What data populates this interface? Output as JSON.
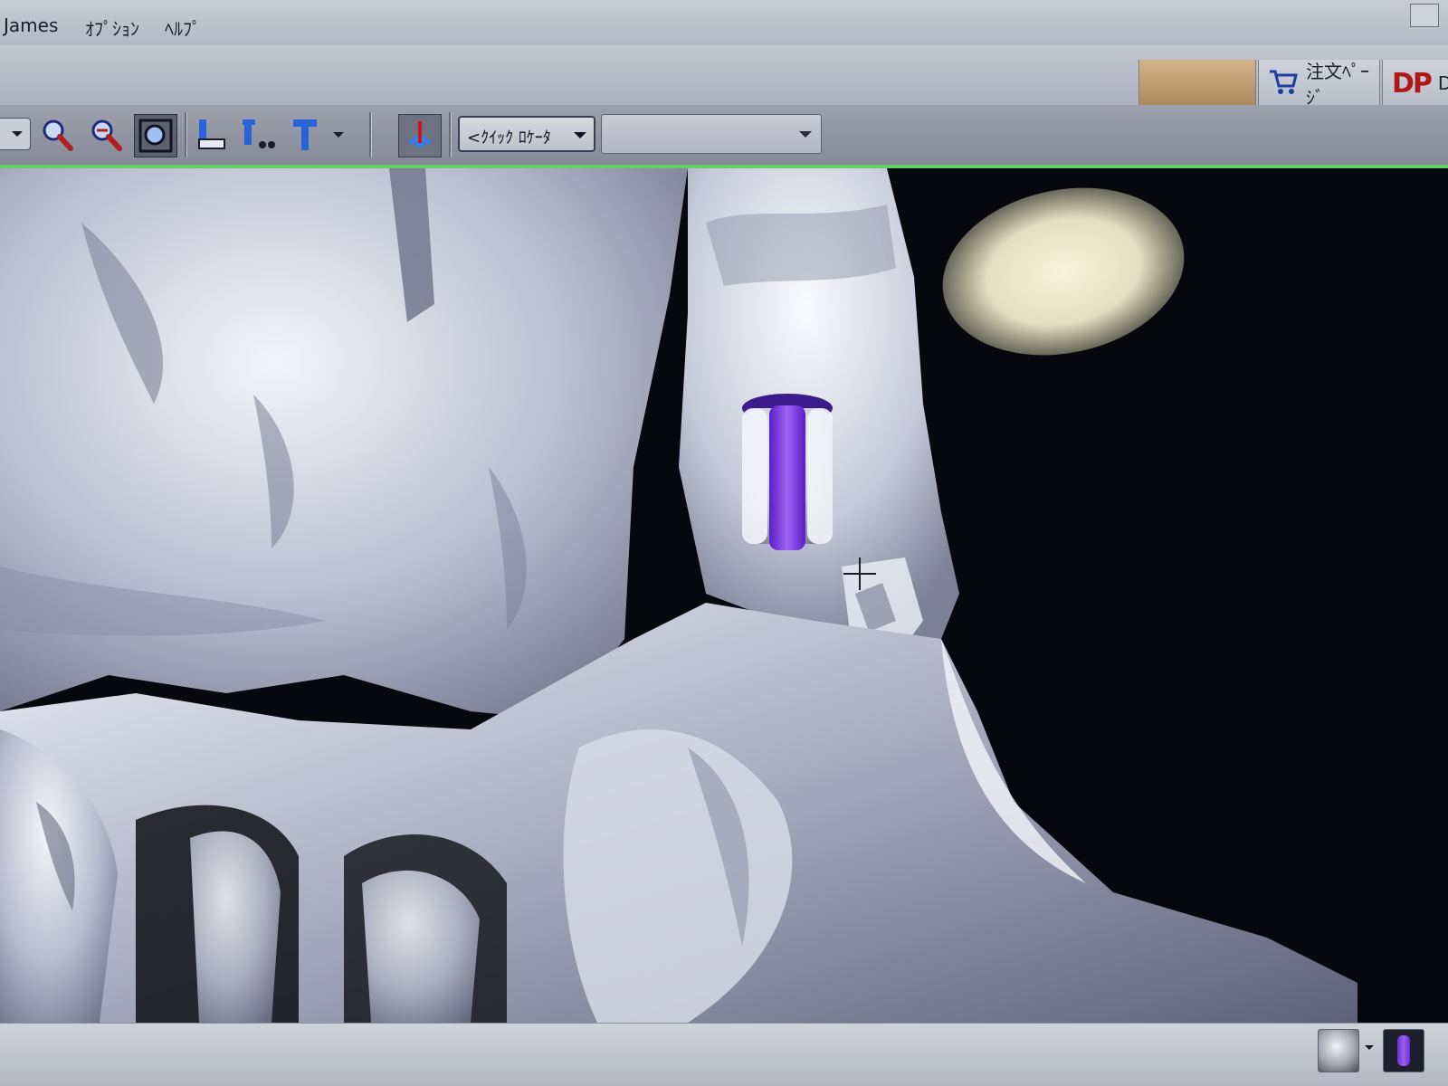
{
  "menu": {
    "items": [
      "James",
      "ｵﾌﾟｼｮﾝ",
      "ﾍﾙﾌﾟ"
    ]
  },
  "topbar": {
    "order_page_label": "注文ﾍﾟｰｼﾞ",
    "dp_logo": "DP",
    "dp_text": "Den"
  },
  "toolbar": {
    "quick_locator_label": "<ｸｲｯｸ ﾛｹｰﾀ",
    "search_value": ""
  },
  "icons": {
    "zoom_in": "magnifier-icon",
    "zoom_out": "magnifier-minus-icon",
    "zoom_window": "zoom-window-icon",
    "implant_tool_a": "implant-place-icon",
    "implant_tool_b": "implant-abutment-icon",
    "implant_tool_c": "implant-t-icon",
    "marker": "marker-pin-icon",
    "cart": "cart-icon",
    "cursor": "crosshair-cursor-icon"
  },
  "colors": {
    "accent_green": "#5fd06a",
    "implant_purple": "#7a36e0",
    "bone_gray": "#c3c6d6",
    "dp_red": "#b01818"
  }
}
